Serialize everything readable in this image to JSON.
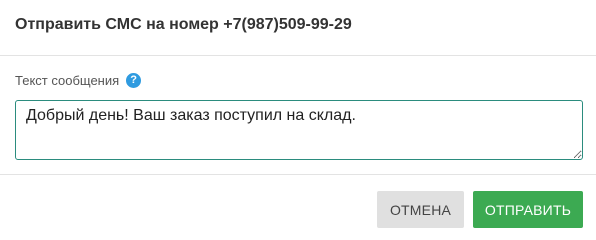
{
  "dialog": {
    "title": "Отправить СМС на номер +7(987)509-99-29"
  },
  "form": {
    "message_label": "Текст сообщения",
    "help_icon_glyph": "?",
    "message_value": "Добрый день! Ваш заказ поступил на склад."
  },
  "footer": {
    "cancel_label": "ОТМЕНА",
    "send_label": "ОТПРАВИТЬ"
  },
  "colors": {
    "accent_help": "#2f9be0",
    "input_border": "#2b8c7e",
    "send_button": "#3caa52",
    "cancel_button": "#e0e0e0"
  }
}
